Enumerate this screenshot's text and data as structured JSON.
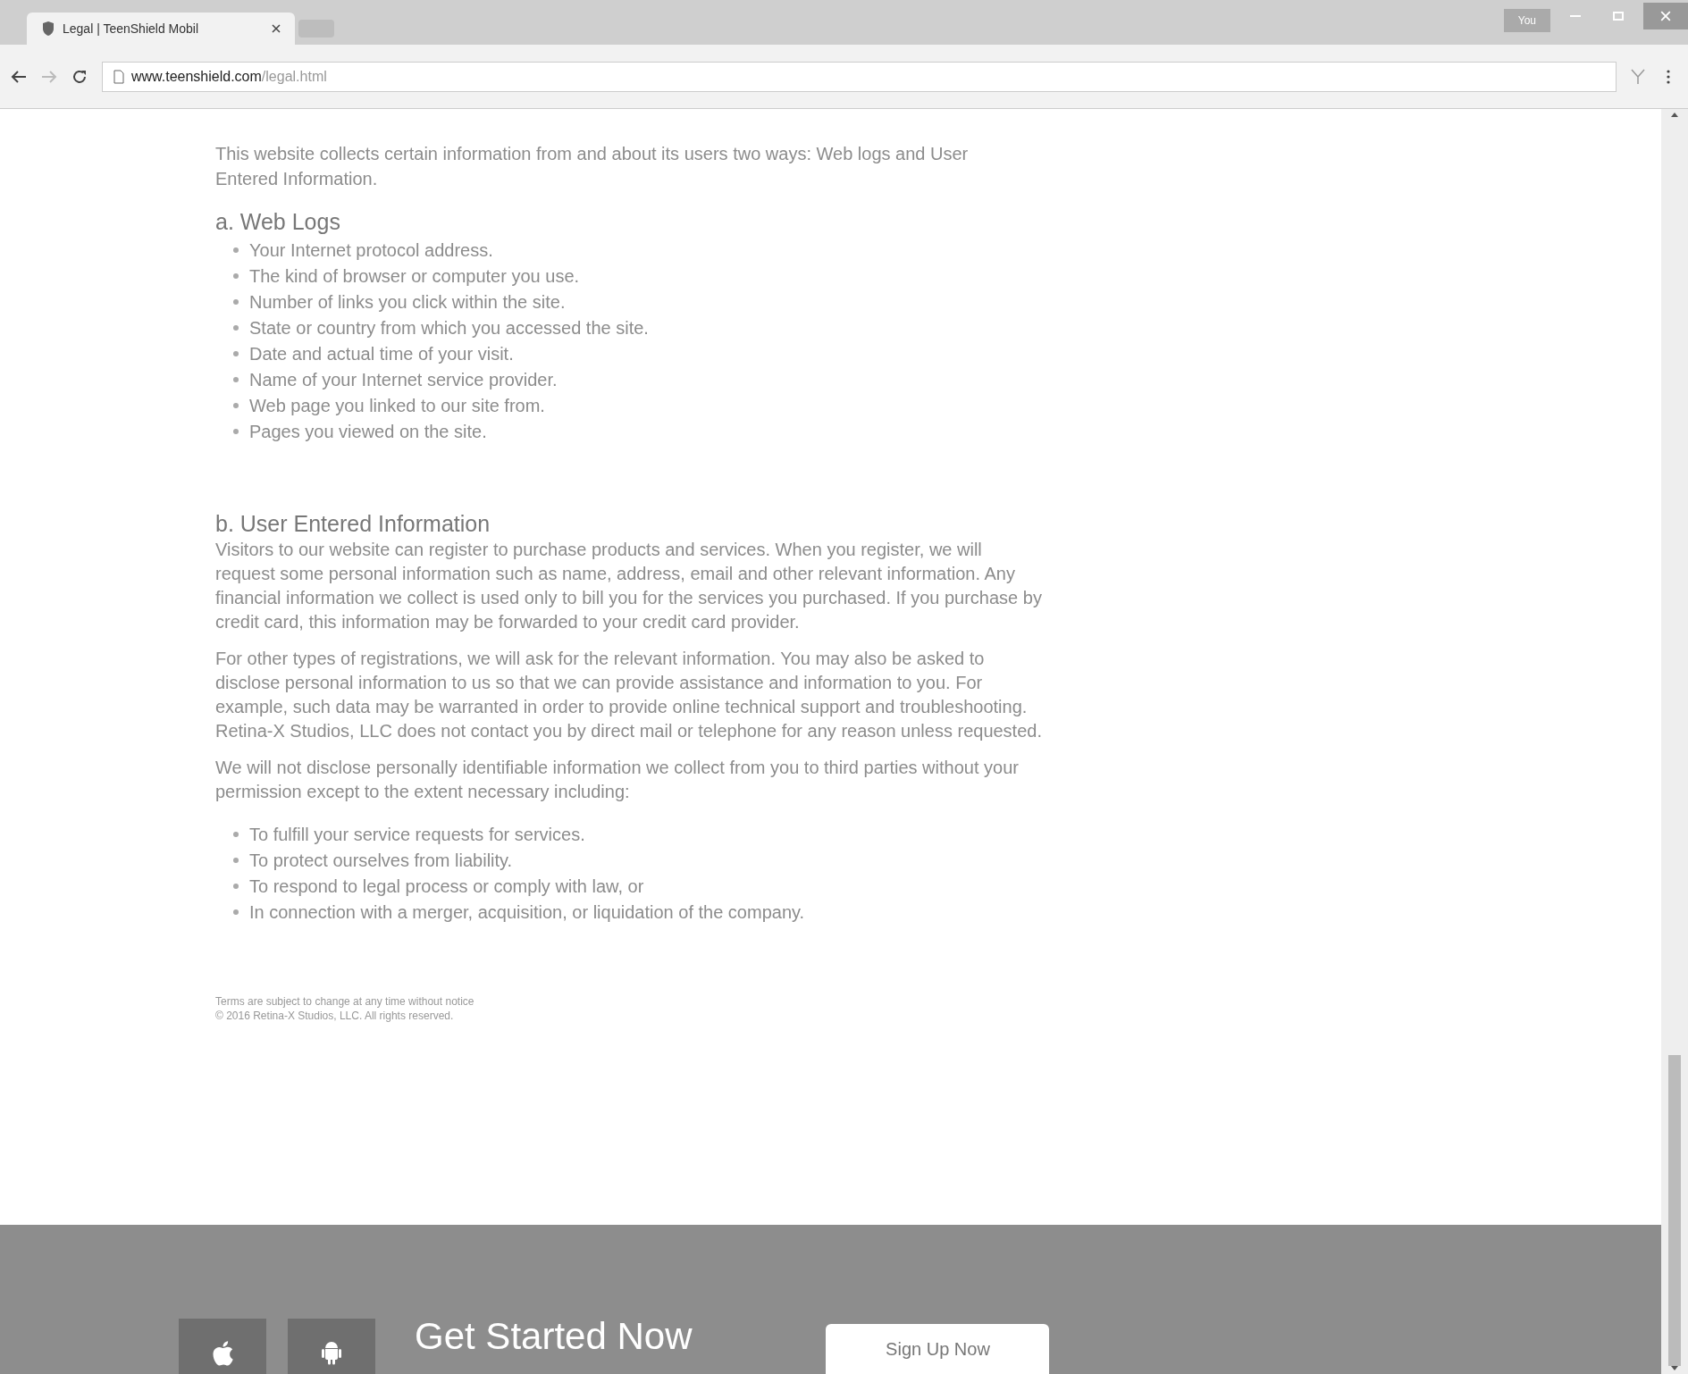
{
  "browser": {
    "profile": "You",
    "tabs": [
      {
        "title": "Legal | TeenShield Mobil",
        "selected": true
      }
    ],
    "url_host": "www.teenshield.com",
    "url_path": "/legal.html"
  },
  "content": {
    "intro": "This website collects certain information from and about its users two ways: Web logs and User Entered Information.",
    "sections": [
      {
        "heading": "a. Web Logs",
        "items": [
          "Your Internet protocol address.",
          "The kind of browser or computer you use.",
          "Number of links you click within the site.",
          "State or country from which you accessed the site.",
          "Date and actual time of your visit.",
          "Name of your Internet service provider.",
          "Web page you linked to our site from.",
          "Pages you viewed on the site."
        ]
      },
      {
        "heading": "b. User Entered Information",
        "paragraphs": [
          "Visitors to our website can register to purchase products and services. When you register, we will request some personal information such as name, address, email and other relevant information. Any financial information we collect is used only to bill you for the services you purchased. If you purchase by credit card, this information may be forwarded to your credit card provider.",
          "For other types of registrations, we will ask for the relevant information. You may also be asked to disclose personal information to us so that we can provide assistance and information to you. For example, such data may be warranted in order to provide online technical support and troubleshooting. Retina-X Studios, LLC does not contact you by direct mail or telephone for any reason unless requested.",
          "We will not disclose personally identifiable information we collect from you to third parties without your permission except to the extent necessary including:"
        ],
        "items": [
          "To fulfill your service requests for services.",
          "To protect ourselves from liability.",
          "To respond to legal process or comply with law, or",
          "In connection with a merger, acquisition, or liquidation of the company."
        ]
      }
    ],
    "notes": [
      "Terms are subject to change at any time without notice",
      "© 2016 Retina-X Studios, LLC. All rights reserved."
    ]
  },
  "footer": {
    "title": "Get Started Now",
    "button": "Sign Up Now"
  }
}
